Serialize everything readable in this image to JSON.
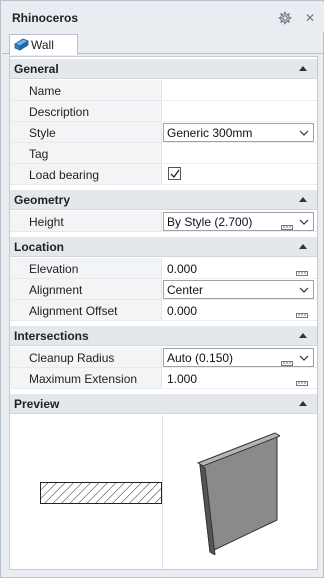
{
  "window": {
    "title": "Rhinoceros"
  },
  "tab": {
    "label": "Wall"
  },
  "sections": {
    "general": {
      "title": "General"
    },
    "geometry": {
      "title": "Geometry"
    },
    "location": {
      "title": "Location"
    },
    "intersections": {
      "title": "Intersections"
    },
    "preview": {
      "title": "Preview"
    }
  },
  "general": {
    "name": {
      "label": "Name",
      "value": ""
    },
    "description": {
      "label": "Description",
      "value": ""
    },
    "style": {
      "label": "Style",
      "value": "Generic 300mm"
    },
    "tag": {
      "label": "Tag",
      "value": ""
    },
    "load_bearing": {
      "label": "Load bearing",
      "checked": true
    }
  },
  "geometry": {
    "height": {
      "label": "Height",
      "value": "By Style (2.700)"
    }
  },
  "location": {
    "elevation": {
      "label": "Elevation",
      "value": "0.000"
    },
    "alignment": {
      "label": "Alignment",
      "value": "Center"
    },
    "alignment_offset": {
      "label": "Alignment Offset",
      "value": "0.000"
    }
  },
  "intersections": {
    "cleanup_radius": {
      "label": "Cleanup Radius",
      "value": "Auto (0.150)"
    },
    "maximum_extension": {
      "label": "Maximum Extension",
      "value": "1.000"
    }
  },
  "icons": {
    "settings": "gear-icon",
    "close": "close-icon",
    "tab": "wall-icon",
    "collapse": "triangle-up-icon",
    "dropdown": "chevron-down-icon",
    "units": "ruler-icon"
  },
  "colors": {
    "accent": "#2f7fc1",
    "section_header": "#e4e7eb",
    "wall_preview": "#8a8a8a"
  }
}
